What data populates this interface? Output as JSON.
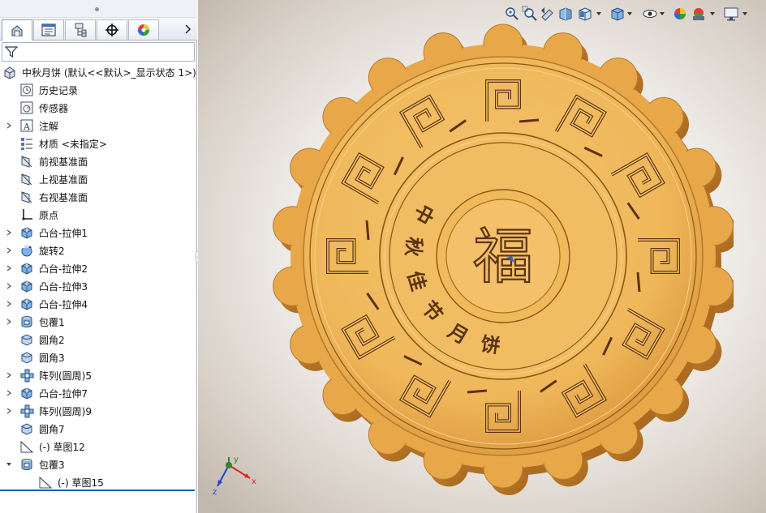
{
  "feature_tree": {
    "root": {
      "label": "中秋月饼  (默认<<默认>_显示状态 1>)",
      "icon": "part-icon"
    },
    "items": [
      {
        "label": "历史记录",
        "icon": "history-icon",
        "expandable": false,
        "indent": 1
      },
      {
        "label": "传感器",
        "icon": "sensor-icon",
        "expandable": false,
        "indent": 1
      },
      {
        "label": "注解",
        "icon": "annotation-icon",
        "expandable": true,
        "indent": 1
      },
      {
        "label": "材质 <未指定>",
        "icon": "material-icon",
        "expandable": false,
        "indent": 1
      },
      {
        "label": "前视基准面",
        "icon": "plane-icon",
        "expandable": false,
        "indent": 1
      },
      {
        "label": "上视基准面",
        "icon": "plane-icon",
        "expandable": false,
        "indent": 1
      },
      {
        "label": "右视基准面",
        "icon": "plane-icon",
        "expandable": false,
        "indent": 1
      },
      {
        "label": "原点",
        "icon": "origin-icon",
        "expandable": false,
        "indent": 1
      },
      {
        "label": "凸台-拉伸1",
        "icon": "extrude-icon",
        "expandable": true,
        "indent": 1
      },
      {
        "label": "旋转2",
        "icon": "revolve-icon",
        "expandable": true,
        "indent": 1
      },
      {
        "label": "凸台-拉伸2",
        "icon": "extrude-icon",
        "expandable": true,
        "indent": 1
      },
      {
        "label": "凸台-拉伸3",
        "icon": "extrude-icon",
        "expandable": true,
        "indent": 1
      },
      {
        "label": "凸台-拉伸4",
        "icon": "extrude-icon",
        "expandable": true,
        "indent": 1
      },
      {
        "label": "包覆1",
        "icon": "wrap-icon",
        "expandable": true,
        "indent": 1
      },
      {
        "label": "圆角2",
        "icon": "fillet-icon",
        "expandable": false,
        "indent": 1
      },
      {
        "label": "圆角3",
        "icon": "fillet-icon",
        "expandable": false,
        "indent": 1
      },
      {
        "label": "阵列(圆周)5",
        "icon": "circular-pattern-icon",
        "expandable": true,
        "indent": 1
      },
      {
        "label": "凸台-拉伸7",
        "icon": "extrude-icon",
        "expandable": true,
        "indent": 1
      },
      {
        "label": "阵列(圆周)9",
        "icon": "circular-pattern-icon",
        "expandable": true,
        "indent": 1
      },
      {
        "label": "圆角7",
        "icon": "fillet-icon",
        "expandable": false,
        "indent": 1
      },
      {
        "label": "(-) 草图12",
        "icon": "sketch-icon",
        "expandable": false,
        "indent": 1
      },
      {
        "label": "包覆3",
        "icon": "wrap-icon",
        "expandable": true,
        "expanded": true,
        "indent": 1
      },
      {
        "label": "(-) 草图15",
        "icon": "sketch-icon",
        "expandable": false,
        "indent": 2
      }
    ]
  },
  "tabs": [
    {
      "name": "feature-manager-tab",
      "icon": "feature-manager-icon",
      "active": true
    },
    {
      "name": "property-manager-tab",
      "icon": "property-manager-icon",
      "active": false
    },
    {
      "name": "configuration-manager-tab",
      "icon": "configuration-manager-icon",
      "active": false
    },
    {
      "name": "dimxpert-manager-tab",
      "icon": "crosshair-icon",
      "active": false
    },
    {
      "name": "display-manager-tab",
      "icon": "appearance-icon",
      "active": false
    }
  ],
  "heads_up_toolbar": [
    "zoom-to-fit-icon",
    "zoom-to-area-icon",
    "previous-view-icon",
    "section-view-icon",
    "view-orientation-icon",
    "display-style-icon",
    "hide-show-items-icon",
    "edit-appearance-icon",
    "apply-scene-icon",
    "view-settings-icon"
  ],
  "model": {
    "center_character": "福",
    "ring_text": [
      "中",
      "秋",
      "佳",
      "节",
      "月",
      "饼"
    ],
    "colors": {
      "body": "#e8a84a",
      "face": "#efb75a",
      "shadow": "#a5671f",
      "line": "#5a3410"
    }
  },
  "triad": {
    "x_label": "x",
    "y_label": "y",
    "z_label": "z"
  }
}
